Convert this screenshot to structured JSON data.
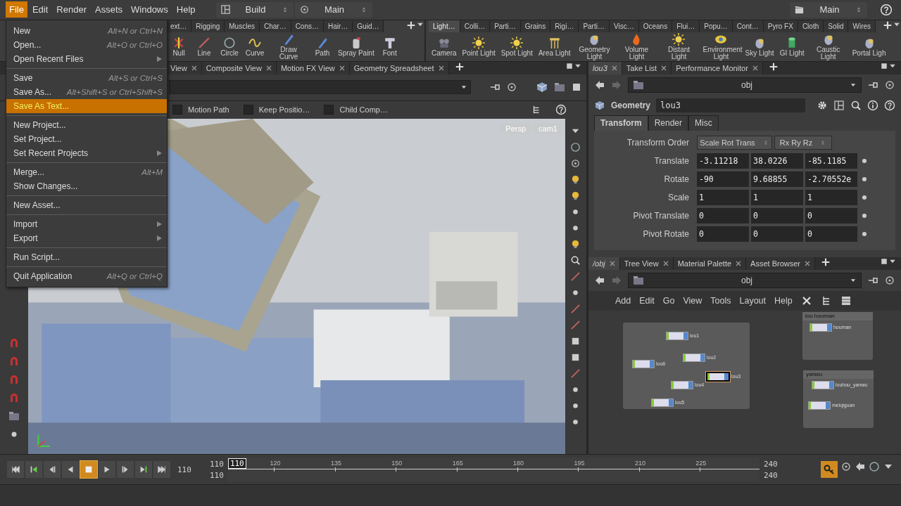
{
  "menubar": {
    "menus": [
      {
        "label": "File",
        "selected": true
      },
      {
        "label": "Edit",
        "selected": false
      },
      {
        "label": "Render",
        "selected": false
      },
      {
        "label": "Assets",
        "selected": false
      },
      {
        "label": "Windows",
        "selected": false
      },
      {
        "label": "Help",
        "selected": false
      }
    ],
    "desktop": "Build",
    "context": "Main",
    "right_context": "Main"
  },
  "file_menu": {
    "groups": [
      [
        {
          "label": "New",
          "shortcut": "Alt+N or Ctrl+N",
          "submenu": false,
          "selected": false
        },
        {
          "label": "Open...",
          "shortcut": "Alt+O or Ctrl+O",
          "submenu": false,
          "selected": false
        },
        {
          "label": "Open Recent Files",
          "submenu": true,
          "selected": false
        }
      ],
      [
        {
          "label": "Save",
          "shortcut": "Alt+S or Ctrl+S",
          "submenu": false,
          "selected": false
        },
        {
          "label": "Save As...",
          "shortcut": "Alt+Shift+S or Ctrl+Shift+S",
          "submenu": false,
          "selected": false
        },
        {
          "label": "Save As Text...",
          "submenu": false,
          "selected": true
        }
      ],
      [
        {
          "label": "New Project...",
          "submenu": false,
          "selected": false
        },
        {
          "label": "Set Project...",
          "submenu": false,
          "selected": false
        },
        {
          "label": "Set Recent Projects",
          "submenu": true,
          "selected": false
        }
      ],
      [
        {
          "label": "Merge...",
          "shortcut": "Alt+M",
          "submenu": false,
          "selected": false
        },
        {
          "label": "Show Changes...",
          "submenu": false,
          "selected": false
        }
      ],
      [
        {
          "label": "New Asset...",
          "submenu": false,
          "selected": false
        }
      ],
      [
        {
          "label": "Import",
          "submenu": true,
          "selected": false
        },
        {
          "label": "Export",
          "submenu": true,
          "selected": false
        }
      ],
      [
        {
          "label": "Run Script...",
          "submenu": false,
          "selected": false
        }
      ],
      [
        {
          "label": "Quit Application",
          "shortcut": "Alt+Q or Ctrl+Q",
          "submenu": false,
          "selected": false
        }
      ]
    ]
  },
  "shelf_left": {
    "tabs": [
      {
        "label": "ext…",
        "selected": false
      },
      {
        "label": "Rigging",
        "selected": false
      },
      {
        "label": "Muscles",
        "selected": false
      },
      {
        "label": "Char…",
        "selected": false
      },
      {
        "label": "Cons…",
        "selected": false
      },
      {
        "label": "Hair…",
        "selected": false
      },
      {
        "label": "Guid…",
        "selected": false
      }
    ],
    "tools": [
      {
        "label": "Null",
        "kind": "cross"
      },
      {
        "label": "Line",
        "kind": "line"
      },
      {
        "label": "Circle",
        "kind": "circle"
      },
      {
        "label": "Curve",
        "kind": "wave"
      },
      {
        "label": "Draw Curve",
        "kind": "pen"
      },
      {
        "label": "Path",
        "kind": "pen"
      },
      {
        "label": "Spray Paint",
        "kind": "can"
      },
      {
        "label": "Font",
        "kind": "block"
      }
    ]
  },
  "shelf_right": {
    "tabs": [
      {
        "label": "Light…",
        "selected": true
      },
      {
        "label": "Colli…",
        "selected": false
      },
      {
        "label": "Parti…",
        "selected": false
      },
      {
        "label": "Grains",
        "selected": false
      },
      {
        "label": "Rigi…",
        "selected": false
      },
      {
        "label": "Parti…",
        "selected": false
      },
      {
        "label": "Visc…",
        "selected": false
      },
      {
        "label": "Oceans",
        "selected": false
      },
      {
        "label": "Flui…",
        "selected": false
      },
      {
        "label": "Popu…",
        "selected": false
      },
      {
        "label": "Cont…",
        "selected": false
      },
      {
        "label": "Pyro FX",
        "selected": false
      },
      {
        "label": "Cloth",
        "selected": false
      },
      {
        "label": "Solid",
        "selected": false
      },
      {
        "label": "Wires",
        "selected": false
      }
    ],
    "tools": [
      {
        "label": "Camera",
        "kind": "camera"
      },
      {
        "label": "Point Light",
        "kind": "sun"
      },
      {
        "label": "Spot Light",
        "kind": "sun"
      },
      {
        "label": "Area Light",
        "kind": "lamp"
      },
      {
        "label": "Geometry Light",
        "kind": "blob"
      },
      {
        "label": "Volume Light",
        "kind": "flame"
      },
      {
        "label": "Distant Light",
        "kind": "sun"
      },
      {
        "label": "Environment Light",
        "kind": "eye"
      },
      {
        "label": "Sky Light",
        "kind": "blob"
      },
      {
        "label": "GI Light",
        "kind": "cylinder"
      },
      {
        "label": "Caustic Light",
        "kind": "blob"
      },
      {
        "label": "Portal Ligh",
        "kind": "blob"
      }
    ]
  },
  "viewer": {
    "tabs": [
      {
        "label": "View",
        "selected": false
      },
      {
        "label": "Composite View",
        "selected": false
      },
      {
        "label": "Motion FX View",
        "selected": false
      },
      {
        "label": "Geometry Spreadsheet",
        "selected": false
      }
    ],
    "options": [
      {
        "label": "Motion Path",
        "checked": false
      },
      {
        "label": "Keep Positio…",
        "checked": false
      },
      {
        "label": "Child Comp…",
        "checked": false
      }
    ],
    "view_menus": [
      "Persp",
      "cam1"
    ]
  },
  "parameters": {
    "tabs": [
      {
        "label": "lou3",
        "selected": true
      },
      {
        "label": "Take List",
        "selected": false
      },
      {
        "label": "Performance Monitor",
        "selected": false
      }
    ],
    "path": "obj",
    "node_type": "Geometry",
    "node_name": "lou3",
    "param_tabs": [
      {
        "label": "Transform",
        "selected": true
      },
      {
        "label": "Render",
        "selected": false
      },
      {
        "label": "Misc",
        "selected": false
      }
    ],
    "transform_order": {
      "label": "Transform Order",
      "values": [
        "Scale Rot Trans",
        "Rx Ry Rz"
      ]
    },
    "rows": [
      {
        "label": "Translate",
        "values": [
          "-3.11218",
          "38.0226",
          "-85.1185"
        ]
      },
      {
        "label": "Rotate",
        "values": [
          "-90",
          "9.68855",
          "-2.70552e"
        ]
      },
      {
        "label": "Scale",
        "values": [
          "1",
          "1",
          "1"
        ]
      },
      {
        "label": "Pivot Translate",
        "values": [
          "0",
          "0",
          "0"
        ]
      },
      {
        "label": "Pivot Rotate",
        "values": [
          "0",
          "0",
          "0"
        ]
      }
    ]
  },
  "network": {
    "tabs": [
      {
        "label": "/obj",
        "selected": true
      },
      {
        "label": "Tree View",
        "selected": false
      },
      {
        "label": "Material Palette",
        "selected": false
      },
      {
        "label": "Asset Browser",
        "selected": false
      }
    ],
    "path": "obj",
    "menus": [
      "Add",
      "Edit",
      "Go",
      "View",
      "Tools",
      "Layout",
      "Help"
    ],
    "boxes": [
      {
        "nodes": [
          {
            "name": "lou1",
            "selected": false
          },
          {
            "name": "lou2",
            "selected": false
          },
          {
            "name": "lou6",
            "selected": false
          },
          {
            "name": "lou3",
            "selected": true
          },
          {
            "name": "lou4",
            "selected": false
          },
          {
            "name": "lou5",
            "selected": false
          }
        ]
      },
      {
        "title": "lou houman",
        "nodes": [
          {
            "name": "houman",
            "selected": false
          }
        ]
      },
      {
        "title": "yanwu",
        "nodes": [
          {
            "name": "louhou_yanwu",
            "selected": false
          },
          {
            "name": "meiqiguan",
            "selected": false
          }
        ]
      }
    ]
  },
  "timeline": {
    "transport": [
      {
        "kind": "first",
        "selected": false
      },
      {
        "kind": "prevkey",
        "selected": false
      },
      {
        "kind": "stepback",
        "selected": false
      },
      {
        "kind": "reverse",
        "selected": false
      },
      {
        "kind": "stop",
        "selected": true
      },
      {
        "kind": "play",
        "selected": false
      },
      {
        "kind": "stepfwd",
        "selected": false
      },
      {
        "kind": "nextkey",
        "selected": false
      },
      {
        "kind": "last",
        "selected": false
      }
    ],
    "frame": "110",
    "range_start": [
      "110",
      "110"
    ],
    "current": "110",
    "ticks": [
      "120",
      "135",
      "150",
      "165",
      "180",
      "195",
      "210",
      "225"
    ],
    "range_end": [
      "240",
      "240"
    ]
  }
}
